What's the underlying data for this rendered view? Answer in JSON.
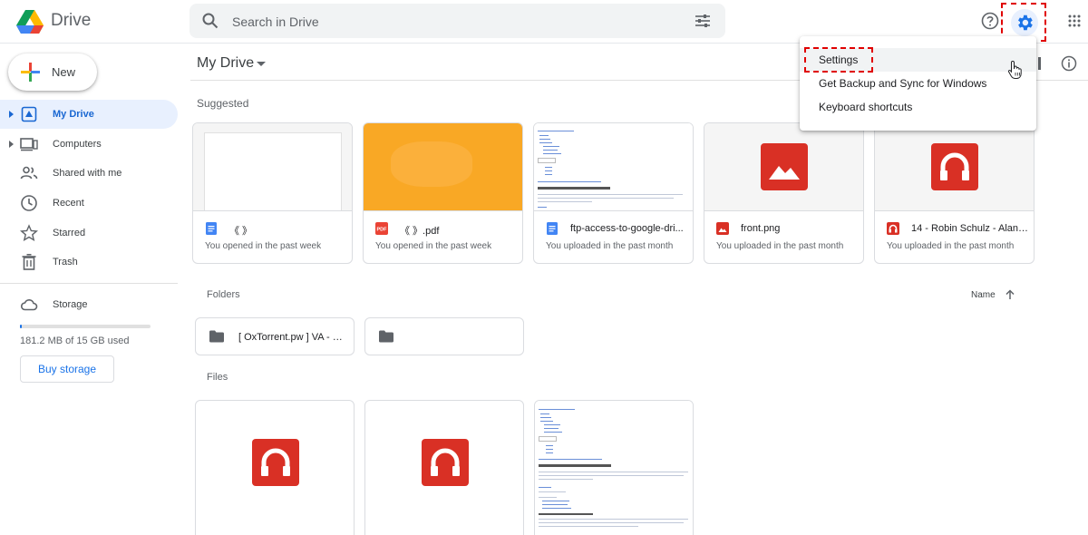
{
  "header": {
    "brand": "Drive",
    "search_placeholder": "Search in Drive"
  },
  "sidebar": {
    "new_label": "New",
    "items": [
      {
        "label": "My Drive"
      },
      {
        "label": "Computers"
      },
      {
        "label": "Shared with me"
      },
      {
        "label": "Recent"
      },
      {
        "label": "Starred"
      },
      {
        "label": "Trash"
      }
    ],
    "storage_label": "Storage",
    "storage_used_text": "181.2 MB of 15 GB used",
    "storage_used_fraction": 0.012,
    "buy_storage": "Buy storage"
  },
  "main": {
    "title": "My Drive",
    "suggested_label": "Suggested",
    "folders_label": "Folders",
    "files_label": "Files",
    "sort_label": "Name",
    "suggested": [
      {
        "name": "《        》",
        "meta": "You opened in the past week"
      },
      {
        "name": "《        》.pdf",
        "meta": "You opened in the past week"
      },
      {
        "name": "ftp-access-to-google-dri...",
        "meta": "You uploaded in the past month"
      },
      {
        "name": "front.png",
        "meta": "You uploaded in the past month"
      },
      {
        "name": "14 - Robin Schulz - Alane...",
        "meta": "You uploaded in the past month"
      }
    ],
    "folders": [
      {
        "name": "[ OxTorrent.pw ] VA - HI..."
      },
      {
        "name": ""
      }
    ]
  },
  "menu": {
    "items": [
      {
        "label": "Settings"
      },
      {
        "label": "Get Backup and Sync for Windows"
      },
      {
        "label": "Keyboard shortcuts"
      }
    ]
  },
  "colors": {
    "accent": "#1a73e8",
    "active_bg": "#e8f0fe",
    "highlight": "#e00000",
    "image_red": "#d93025",
    "pdf_thumb": "#f9a825"
  }
}
